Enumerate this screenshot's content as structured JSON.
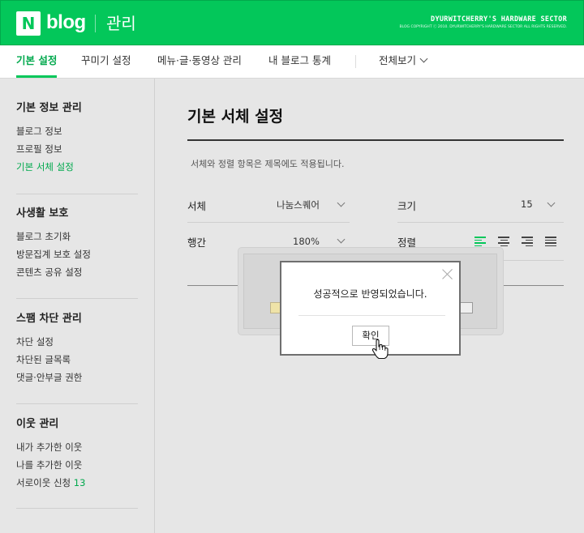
{
  "header": {
    "logo_letter": "N",
    "logo_text": "blog",
    "title": "관리",
    "brand_line1": "DYURWITCHERRY'S HARDWARE SECTOR",
    "brand_line2": "BLOG COPYRIGHT ⓒ 2010. DYURWITCHERRY'S HARDWARE SECTOR ALL RIGHTS RESERVED.",
    "bg_color": "#03c75a"
  },
  "tabs": [
    {
      "label": "기본 설정",
      "active": true
    },
    {
      "label": "꾸미기 설정",
      "active": false
    },
    {
      "label": "메뉴·글·동영상 관리",
      "active": false
    },
    {
      "label": "내 블로그 통계",
      "active": false
    },
    {
      "label": "전체보기",
      "active": false,
      "icon": "chevron-down-icon"
    }
  ],
  "sidebar": {
    "groups": [
      {
        "title": "기본 정보 관리",
        "items": [
          "블로그 정보",
          "프로필 정보",
          "기본 서체 설정"
        ],
        "active_index": 2
      },
      {
        "title": "사생활 보호",
        "items": [
          "블로그 초기화",
          "방문집계 보호 설정",
          "콘텐츠 공유 설정"
        ]
      },
      {
        "title": "스팸 차단 관리",
        "items": [
          "차단 설정",
          "차단된 글목록",
          "댓글·안부글 권한"
        ]
      },
      {
        "title": "이웃 관리",
        "items": [
          "내가 추가한 이웃",
          "나를 추가한 이웃",
          "서로이웃 신청"
        ],
        "neighbor_request_count": "13"
      }
    ]
  },
  "main": {
    "title": "기본 서체 설정",
    "description": "서체와 정렬 항목은 제목에도 적용됩니다.",
    "font_label": "서체",
    "font_value": "나눔스퀘어",
    "size_label": "크기",
    "size_value": "15",
    "line_height_label": "행간",
    "line_height_value": "180%",
    "align_label": "정렬",
    "align_options": [
      "align-left-icon",
      "align-center-icon",
      "align-right-icon",
      "align-justify-icon"
    ],
    "align_selected": 0
  },
  "dialog": {
    "message": "성공적으로 반영되었습니다.",
    "confirm_label": "확인"
  },
  "colors": {
    "accent": "#03c75a",
    "accent_text": "#03a94e"
  }
}
